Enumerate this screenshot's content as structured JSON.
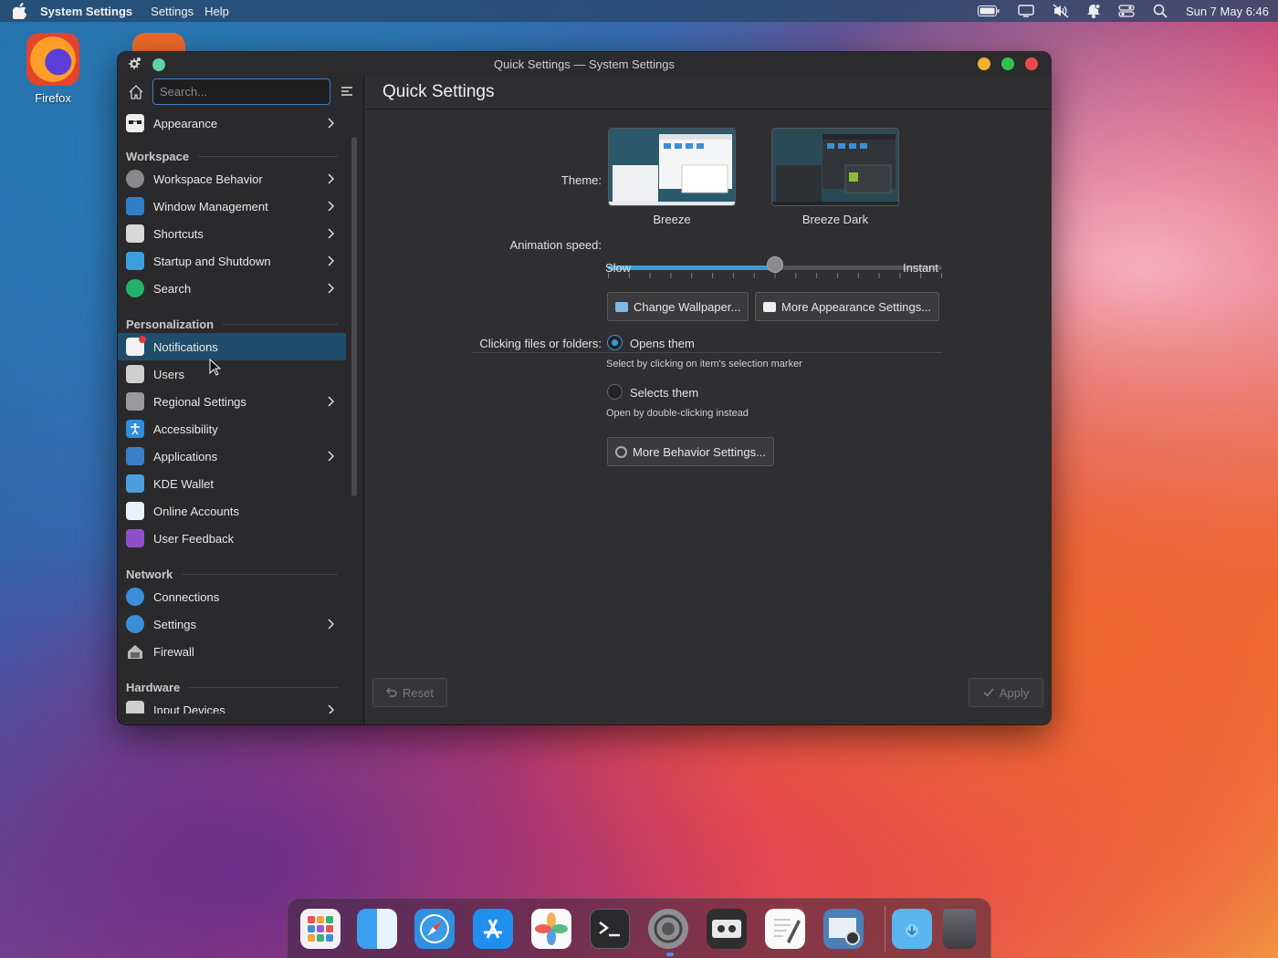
{
  "menubar": {
    "app_name": "System Settings",
    "menus": [
      "Settings",
      "Help"
    ],
    "clock": "Sun 7 May 6:46",
    "status_icons": [
      "battery-icon",
      "display-icon",
      "volume-muted-icon",
      "bell-icon",
      "control-center-icon",
      "search-icon"
    ]
  },
  "desktop": {
    "icons": [
      {
        "label": "Firefox",
        "icon": "firefox-icon"
      }
    ]
  },
  "window": {
    "title": "Quick Settings — System Settings",
    "search_placeholder": "Search...",
    "page_title": "Quick Settings",
    "sidebar": {
      "items": [
        {
          "label": "Appearance",
          "icon": "appearance-icon",
          "chevron": true
        },
        {
          "section": "Workspace"
        },
        {
          "label": "Workspace Behavior",
          "icon": "workspace-behavior-icon",
          "chevron": true
        },
        {
          "label": "Window Management",
          "icon": "window-management-icon",
          "chevron": true
        },
        {
          "label": "Shortcuts",
          "icon": "shortcuts-icon",
          "chevron": true
        },
        {
          "label": "Startup and Shutdown",
          "icon": "startup-icon",
          "chevron": true
        },
        {
          "label": "Search",
          "icon": "search-icon",
          "chevron": true
        },
        {
          "section": "Personalization"
        },
        {
          "label": "Notifications",
          "icon": "notifications-icon",
          "selected": true
        },
        {
          "label": "Users",
          "icon": "users-icon"
        },
        {
          "label": "Regional Settings",
          "icon": "regional-icon",
          "chevron": true
        },
        {
          "label": "Accessibility",
          "icon": "accessibility-icon"
        },
        {
          "label": "Applications",
          "icon": "applications-icon",
          "chevron": true
        },
        {
          "label": "KDE Wallet",
          "icon": "wallet-icon"
        },
        {
          "label": "Online Accounts",
          "icon": "cloud-icon"
        },
        {
          "label": "User Feedback",
          "icon": "feedback-icon"
        },
        {
          "section": "Network"
        },
        {
          "label": "Connections",
          "icon": "connections-icon"
        },
        {
          "label": "Settings",
          "icon": "network-settings-icon",
          "chevron": true
        },
        {
          "label": "Firewall",
          "icon": "firewall-icon"
        },
        {
          "section": "Hardware"
        },
        {
          "label": "Input Devices",
          "icon": "input-devices-icon",
          "chevron": true
        }
      ]
    },
    "quick": {
      "theme_label": "Theme:",
      "themes": [
        "Breeze",
        "Breeze Dark"
      ],
      "animation_label": "Animation speed:",
      "slider_min_label": "Slow",
      "slider_max_label": "Instant",
      "slider_value": 0.5,
      "change_wallpaper": "Change Wallpaper...",
      "more_appearance": "More Appearance Settings...",
      "click_label": "Clicking files or folders:",
      "opt_open": "Opens them",
      "opt_open_hint": "Select by clicking on item's selection marker",
      "opt_select": "Selects them",
      "opt_select_hint": "Open by double-clicking instead",
      "more_behavior": "More Behavior Settings...",
      "reset": "Reset",
      "apply": "Apply"
    }
  },
  "dock": {
    "icons": [
      "launchpad-icon",
      "finder-icon",
      "safari-icon",
      "app-store-icon",
      "photos-icon",
      "terminal-icon",
      "system-settings-icon",
      "cassette-icon",
      "text-editor-icon",
      "preview-icon",
      "downloads-folder-icon",
      "trash-icon"
    ]
  }
}
